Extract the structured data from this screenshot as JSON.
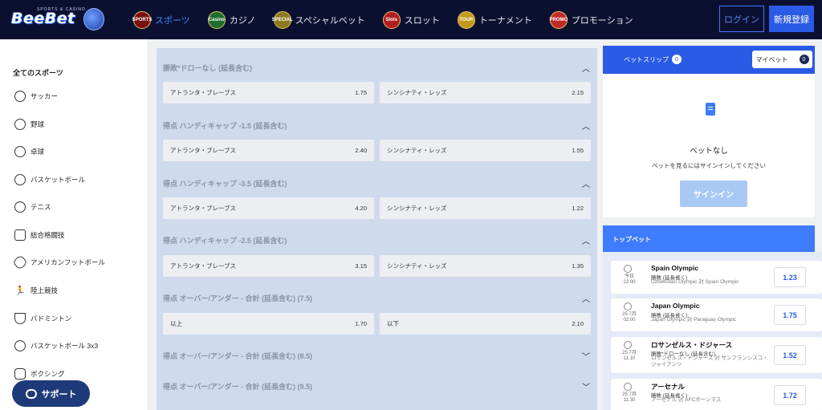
{
  "header": {
    "logo": "BeeBet",
    "logo_sub": "SPORTS & CASINO",
    "nav": [
      {
        "label": "スポーツ",
        "badge": "SPORTS",
        "active": true
      },
      {
        "label": "カジノ",
        "badge": "Casino",
        "active": false
      },
      {
        "label": "スペシャルベット",
        "badge": "SPECIAL",
        "active": false
      },
      {
        "label": "スロット",
        "badge": "Slots",
        "active": false
      },
      {
        "label": "トーナメント",
        "badge": "TOUR",
        "active": false
      },
      {
        "label": "プロモーション",
        "badge": "PROMO",
        "active": false
      }
    ],
    "login_label": "ログイン",
    "register_label": "新規登録"
  },
  "sidebar": {
    "title": "全てのスポーツ",
    "items": [
      {
        "label": "サッカー",
        "icon": "soccer-icon",
        "glyph": "⚽"
      },
      {
        "label": "野球",
        "icon": "baseball-icon",
        "glyph": ""
      },
      {
        "label": "卓球",
        "icon": "table-tennis-icon",
        "glyph": ""
      },
      {
        "label": "バスケットボール",
        "icon": "basketball-icon",
        "glyph": ""
      },
      {
        "label": "テニス",
        "icon": "tennis-icon",
        "glyph": ""
      },
      {
        "label": "総合格闘技",
        "icon": "mma-glove-icon",
        "glyph": ""
      },
      {
        "label": "アメリカンフットボール",
        "icon": "american-football-icon",
        "glyph": ""
      },
      {
        "label": "陸上競技",
        "icon": "runner-icon",
        "glyph": ""
      },
      {
        "label": "バドミントン",
        "icon": "shuttlecock-icon",
        "glyph": ""
      },
      {
        "label": "バスケットボール 3x3",
        "icon": "basketball-3x3-icon",
        "glyph": ""
      },
      {
        "label": "ボクシング",
        "icon": "boxing-glove-icon",
        "glyph": ""
      }
    ],
    "support_label": "サポート"
  },
  "markets": [
    {
      "title": "勝敗*ドローなし (延長含む)",
      "expanded": true,
      "odds": [
        {
          "name": "アトランタ・ブレーブス",
          "value": "1.75"
        },
        {
          "name": "シンシナティ・レッズ",
          "value": "2.15"
        }
      ]
    },
    {
      "title": "得点 ハンディキャップ -1.5 (延長含む)",
      "expanded": true,
      "odds": [
        {
          "name": "アトランタ・ブレーブス",
          "value": "2.40"
        },
        {
          "name": "シンシナティ・レッズ",
          "value": "1.55"
        }
      ]
    },
    {
      "title": "得点 ハンディキャップ -3.5 (延長含む)",
      "expanded": true,
      "odds": [
        {
          "name": "アトランタ・ブレーブス",
          "value": "4.20"
        },
        {
          "name": "シンシナティ・レッズ",
          "value": "1.22"
        }
      ]
    },
    {
      "title": "得点 ハンディキャップ -2.5 (延長含む)",
      "expanded": true,
      "odds": [
        {
          "name": "アトランタ・ブレーブス",
          "value": "3.15"
        },
        {
          "name": "シンシナティ・レッズ",
          "value": "1.35"
        }
      ]
    },
    {
      "title": "得点 オーバー/アンダー - 合計 (延長含む) (7.5)",
      "expanded": true,
      "odds": [
        {
          "name": "以上",
          "value": "1.70"
        },
        {
          "name": "以下",
          "value": "2.10"
        }
      ]
    },
    {
      "title": "得点 オーバー/アンダー - 合計 (延長含む) (8.5)",
      "expanded": false,
      "odds": []
    },
    {
      "title": "得点 オーバー/アンダー - 合計 (延長含む) (9.5)",
      "expanded": false,
      "odds": []
    }
  ],
  "betslip": {
    "tab_label": "ベットスリップ",
    "tab_count": "0",
    "mybet_label": "マイベット",
    "mybet_count": "0",
    "empty_title": "ベットなし",
    "empty_sub": "ベットを見るにはサインインしてください",
    "signin_label": "サインイン"
  },
  "top_bets": {
    "title": "トップベット",
    "items": [
      {
        "date": "今日",
        "time": "22:00",
        "team": "Spain Olympic",
        "market": "勝敗 (延長省く)",
        "match": "Uzbekistan Olympic 対 Spain Olympic",
        "odd": "1.23"
      },
      {
        "date": "25 7月",
        "time": "02:00",
        "team": "Japan Olympic",
        "market": "勝敗 (延長省く)",
        "match": "Japan Olympic 対 Paraguay Olympic",
        "odd": "1.75"
      },
      {
        "date": "25 7月",
        "time": "11:10",
        "team": "ロサンゼルス・ドジャース",
        "market": "勝敗*ドローなし (延長含む)",
        "match": "ロサンゼルス・ドジャース 対 サンフランシスコ・ジャイアンツ",
        "odd": "1.52"
      },
      {
        "date": "25 7月",
        "time": "11:30",
        "team": "アーセナル",
        "market": "勝敗 (延長省く)",
        "match": "アーセナル 対 AFCボーンマス",
        "odd": "1.72"
      }
    ]
  },
  "colors": {
    "header_bg": "#0c1030",
    "accent": "#2a5be6",
    "active_nav": "#3d8cff",
    "market_bg": "#cfdaec"
  }
}
